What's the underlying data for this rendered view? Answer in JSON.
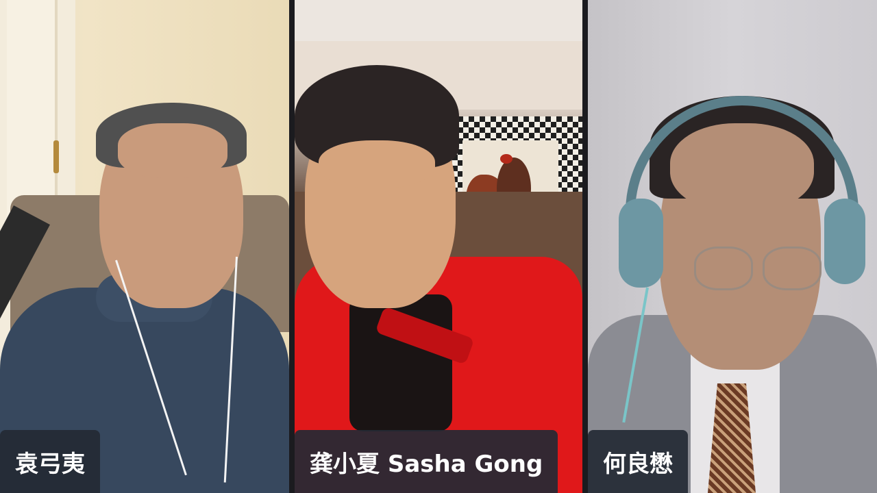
{
  "participants": [
    {
      "name": "袁弓夷"
    },
    {
      "name": "龚小夏 Sasha Gong"
    },
    {
      "name": "何良懋"
    }
  ],
  "colors": {
    "divider": "#1b1b1f",
    "name_tag_bg": "#242a34",
    "name_tag_text": "#ffffff"
  }
}
